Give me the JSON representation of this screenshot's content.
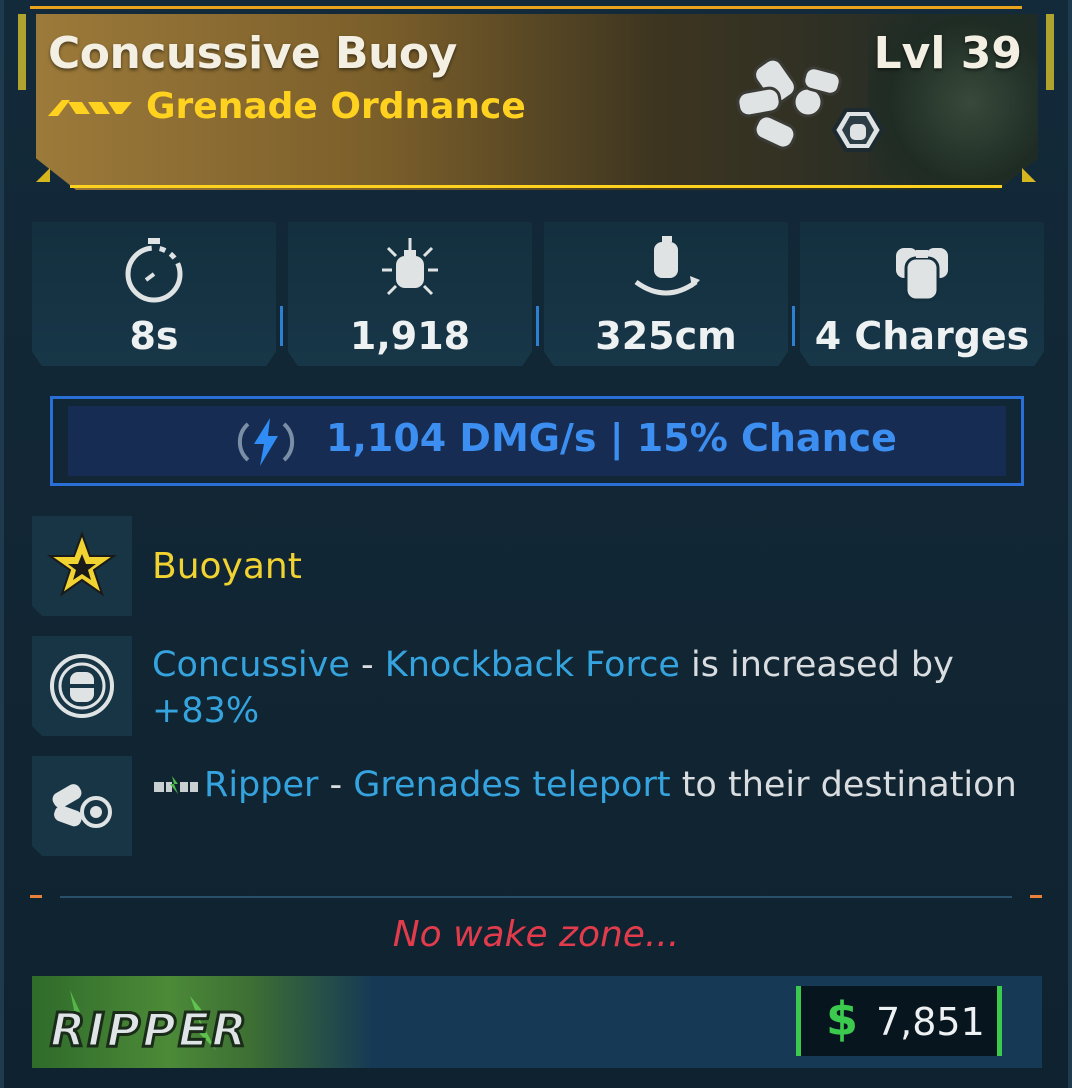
{
  "item": {
    "name": "Concussive Buoy",
    "level": "Lvl 39",
    "type": "Grenade Ordnance",
    "rarity_icon": "triple-chevron-icon",
    "art_icon": "grenade-cluster-icon"
  },
  "stats": [
    {
      "icon": "timer-icon",
      "value": "8s"
    },
    {
      "icon": "grenade-burst-icon",
      "value": "1,918"
    },
    {
      "icon": "grenade-radius-icon",
      "value": "325cm"
    },
    {
      "icon": "grenade-charges-icon",
      "value": "4 Charges"
    }
  ],
  "element": {
    "icon": "lightning-bolt-icon",
    "text": "1,104 DMG/s | 15% Chance",
    "color": "#3c8ef0"
  },
  "perks": {
    "title": {
      "icon": "star-burst-icon",
      "label": "Buoyant"
    },
    "concussive": {
      "icon": "grenade-circle-icon",
      "name": "Concussive",
      "separator": " - ",
      "stat": "Knockback Force",
      "rest": " is increased by ",
      "value": "+83%"
    },
    "ripper": {
      "icon": "teleport-grenade-icon",
      "brand_icon": "ripper-mini-icon",
      "name": "Ripper",
      "separator": " - ",
      "effect": "Grenades teleport",
      "rest": " to their destination"
    }
  },
  "flavor_text": "No wake zone...",
  "footer": {
    "brand_logo_text": "RIPPER",
    "currency_icon": "dollar-icon",
    "currency_symbol": "$",
    "price": "7,851"
  },
  "colors": {
    "accent_yellow": "#ffd21f",
    "perk_blue": "#35a3de",
    "flavor_red": "#e23c4c",
    "money_green": "#3cca4e"
  }
}
